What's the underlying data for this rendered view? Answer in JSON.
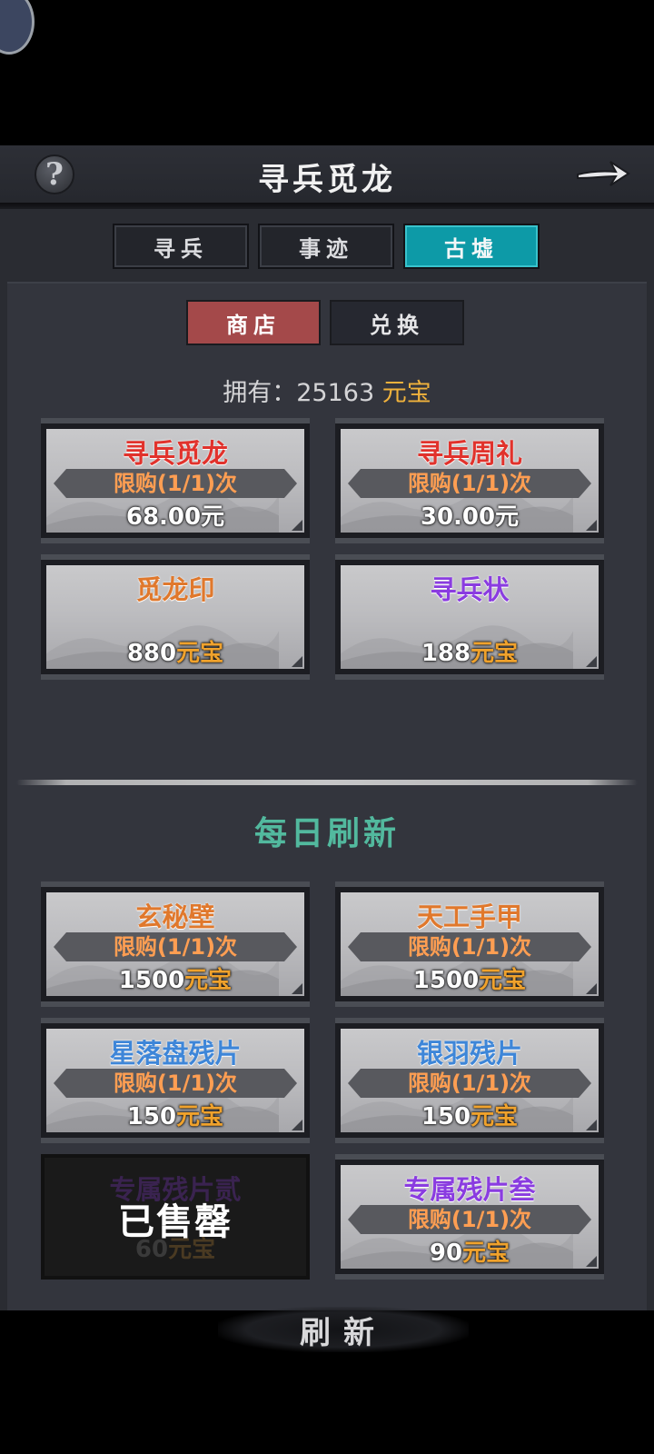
{
  "header": {
    "help_label": "?",
    "title": "寻兵觅龙"
  },
  "main_tabs": [
    {
      "label": "寻兵",
      "active": false
    },
    {
      "label": "事迹",
      "active": false
    },
    {
      "label": "古墟",
      "active": true
    }
  ],
  "sub_tabs": [
    {
      "label": "商店",
      "active": true
    },
    {
      "label": "兑换",
      "active": false
    }
  ],
  "owned": {
    "prefix": "拥有：",
    "amount": "25163",
    "currency": "元宝"
  },
  "shop_items": [
    {
      "name": "寻兵觅龙",
      "limit": "限购(1/1)次",
      "price": "68.00",
      "currency": "元",
      "name_color": "#e1322c"
    },
    {
      "name": "寻兵周礼",
      "limit": "限购(1/1)次",
      "price": "30.00",
      "currency": "元",
      "name_color": "#e1322c"
    },
    {
      "name": "觅龙印",
      "price": "880",
      "currency": "元宝",
      "name_color": "#e0782c"
    },
    {
      "name": "寻兵状",
      "price": "188",
      "currency": "元宝",
      "name_color": "#8a3ce0"
    }
  ],
  "daily": {
    "title": "每日刷新",
    "items": [
      {
        "name": "玄秘壁",
        "limit": "限购(1/1)次",
        "price": "1500",
        "currency": "元宝",
        "name_color": "#e0782c"
      },
      {
        "name": "天工手甲",
        "limit": "限购(1/1)次",
        "price": "1500",
        "currency": "元宝",
        "name_color": "#e0782c"
      },
      {
        "name": "星落盘残片",
        "limit": "限购(1/1)次",
        "price": "150",
        "currency": "元宝",
        "name_color": "#3e86d8"
      },
      {
        "name": "银羽残片",
        "limit": "限购(1/1)次",
        "price": "150",
        "currency": "元宝",
        "name_color": "#3e86d8"
      },
      {
        "name": "专属残片贰",
        "price": "60",
        "currency": "元宝",
        "sold": true,
        "sold_label": "已售罄"
      },
      {
        "name": "专属残片叁",
        "limit": "限购(1/1)次",
        "price": "90",
        "currency": "元宝",
        "name_color": "#8a3ce0"
      }
    ],
    "refresh_label": "刷新"
  }
}
